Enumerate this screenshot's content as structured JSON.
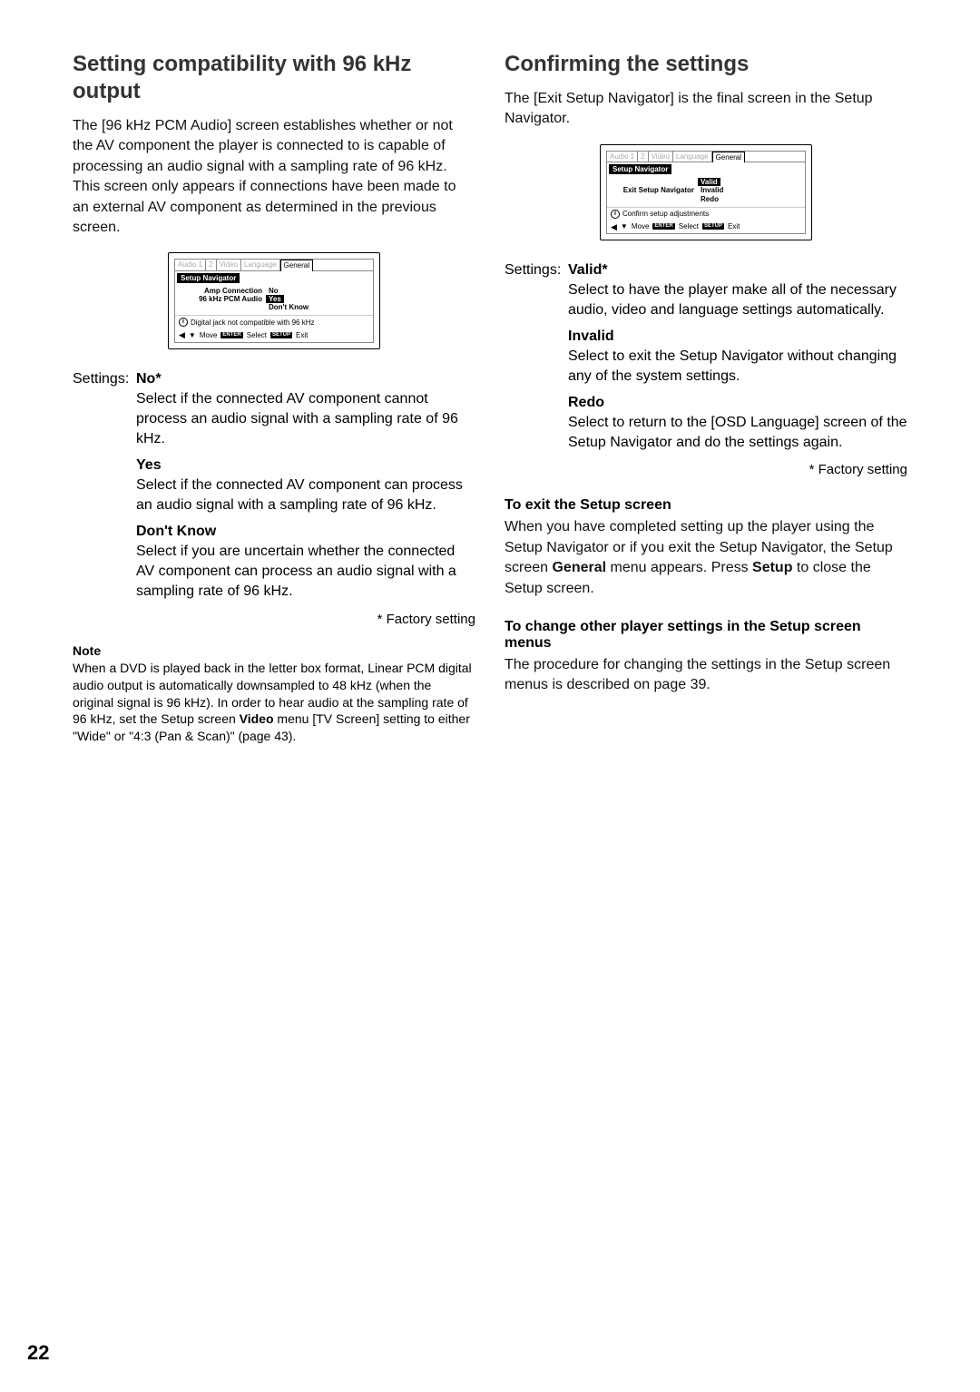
{
  "left": {
    "heading": "Setting compatibility with 96 kHz output",
    "intro": "The [96 kHz PCM Audio] screen establishes whether or not the AV component the player is connected to is capable of processing an audio signal with a sampling rate of 96 kHz. This screen only appears if connections have been made to an external AV component as determined in the previous screen.",
    "osd": {
      "tabs": [
        "Audio 1",
        "2",
        "Video",
        "Language",
        "General"
      ],
      "bar": "Setup Navigator",
      "rows": [
        {
          "l": "Amp Connection",
          "r": "No",
          "hl": false
        },
        {
          "l": "96 kHz PCM Audio",
          "r": "Yes",
          "hl": true
        },
        {
          "l": "",
          "r": "Don't Know",
          "hl": false
        }
      ],
      "hint": "Digital jack not compatible with 96 kHz",
      "nav": {
        "move": "Move",
        "sel": "Select",
        "exit": "Exit",
        "enter": "ENTER",
        "setup": "SETUP"
      }
    },
    "settings_label": "Settings:",
    "options": [
      {
        "name": "No*",
        "desc": "Select if the connected AV component cannot process an audio signal with a sampling rate of 96 kHz."
      },
      {
        "name": "Yes",
        "desc": "Select if the connected AV component can process an audio signal with a sampling rate of 96 kHz."
      },
      {
        "name": "Don't Know",
        "desc": "Select if you are uncertain whether the connected AV component can process an audio signal with a sampling rate of 96 kHz."
      }
    ],
    "factory": "* Factory setting",
    "note_label": "Note",
    "note_pre": "When a DVD is played back in the letter box format, Linear PCM digital audio output is automatically downsampled to 48 kHz (when the original signal is 96 kHz). In order to hear audio at the sampling rate of 96 kHz, set the Setup screen ",
    "note_bold1": "Video",
    "note_mid": " menu [TV Screen] setting to either \"Wide\" or \"4:3 (Pan & Scan)\" (page 43)."
  },
  "right": {
    "heading": "Confirming the settings",
    "intro": "The [Exit Setup Navigator] is the final screen in the Setup Navigator.",
    "osd": {
      "tabs": [
        "Audio 1",
        "2",
        "Video",
        "Language",
        "General"
      ],
      "bar": "Setup Navigator",
      "rows": [
        {
          "l": "",
          "r": "Valid",
          "hl": true
        },
        {
          "l": "Exit Setup Navigator",
          "r": "Invalid",
          "hl": false
        },
        {
          "l": "",
          "r": "Redo",
          "hl": false
        }
      ],
      "hint": "Confirm setup adjustments",
      "nav": {
        "move": "Move",
        "sel": "Select",
        "exit": "Exit",
        "enter": "ENTER",
        "setup": "SETUP"
      }
    },
    "settings_label": "Settings:",
    "options": [
      {
        "name": "Valid*",
        "desc": "Select to have the player make all of the necessary audio, video and language settings automatically."
      },
      {
        "name": "Invalid",
        "desc": "Select to exit the Setup Navigator without changing any of the system settings."
      },
      {
        "name": "Redo",
        "desc": "Select to return to the [OSD Language] screen of the Setup Navigator and do the settings again."
      }
    ],
    "factory": "* Factory setting",
    "sub1_h": "To exit the Setup screen",
    "sub1_p_pre": "When you have completed setting up the player using the Setup Navigator or if you exit the Setup Navigator, the Setup screen ",
    "sub1_b1": "General",
    "sub1_p_mid": " menu appears. Press ",
    "sub1_b2": "Setup",
    "sub1_p_post": " to close the Setup screen.",
    "sub2_h": "To change other player settings in the Setup screen menus",
    "sub2_p": "The procedure for changing the settings in the Setup screen menus is described on page 39."
  },
  "page_number": "22"
}
